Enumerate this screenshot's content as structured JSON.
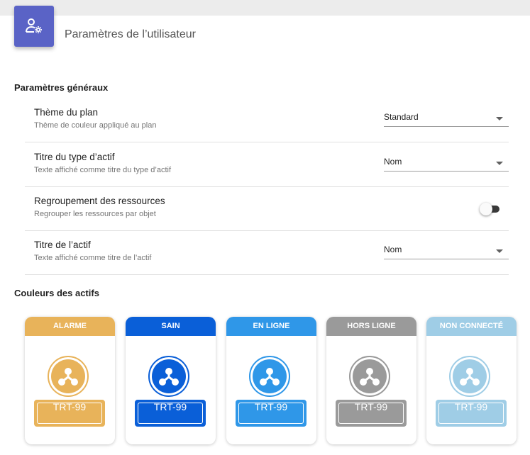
{
  "header": {
    "title": "Paramètres de l’utilisateur",
    "icon": "user-settings-icon"
  },
  "general": {
    "section_title": "Paramètres généraux",
    "settings": [
      {
        "label": "Thème du plan",
        "description": "Thème de couleur appliqué au plan",
        "control": "select",
        "value": "Standard"
      },
      {
        "label": "Titre du type d’actif",
        "description": "Texte affiché comme titre du type d’actif",
        "control": "select",
        "value": "Nom"
      },
      {
        "label": "Regroupement des ressources",
        "description": "Regrouper les ressources par objet",
        "control": "toggle",
        "checked": false
      },
      {
        "label": "Titre de l’actif",
        "description": "Texte affiché comme titre de l’actif",
        "control": "select",
        "value": "Nom"
      }
    ]
  },
  "asset_colors": {
    "section_title": "Couleurs des actifs",
    "cards": [
      {
        "label": "ALARME",
        "tag": "TRT-99",
        "color": "#e8b35a",
        "icon": "network-icon"
      },
      {
        "label": "SAIN",
        "tag": "TRT-99",
        "color": "#0a5fd8",
        "icon": "network-icon"
      },
      {
        "label": "EN LIGNE",
        "tag": "TRT-99",
        "color": "#2f97e8",
        "icon": "network-icon"
      },
      {
        "label": "HORS LIGNE",
        "tag": "TRT-99",
        "color": "#9a9a9a",
        "icon": "network-icon"
      },
      {
        "label": "NON CONNECTÉ",
        "tag": "TRT-99",
        "color": "#9fcde6",
        "icon": "network-icon"
      }
    ]
  },
  "colors": {
    "accent": "#5a63c6"
  }
}
